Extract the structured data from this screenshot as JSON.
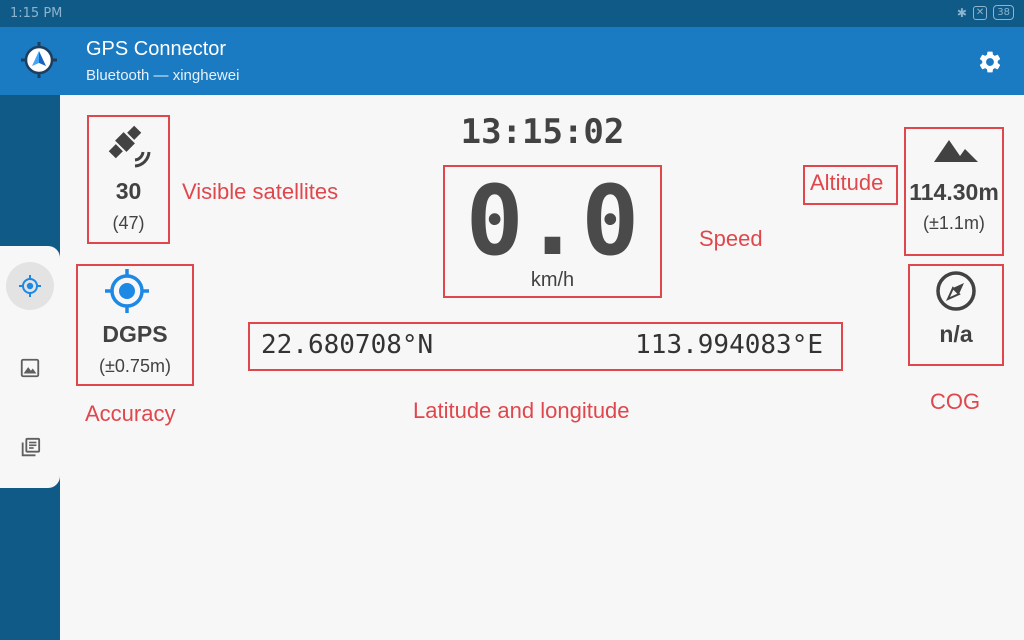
{
  "status_bar": {
    "time": "1:15 PM",
    "battery": "38"
  },
  "app": {
    "title": "GPS Connector",
    "subtitle": "Bluetooth — xinghewei"
  },
  "colors": {
    "appbar": "#1a7ac2",
    "statusbar": "#0f5a86",
    "accent": "#1e88e5",
    "annotation": "#e0474c",
    "text": "#424242"
  },
  "icons": {
    "app": "gps-logo-icon",
    "settings": "gear-icon",
    "satellite": "satellite-icon",
    "accuracy": "gps-fixed-icon",
    "altitude": "terrain-icon",
    "cog": "compass-icon"
  },
  "rail": [
    {
      "name": "rail-location",
      "icon": "crosshair-location-icon",
      "active": true
    },
    {
      "name": "rail-image",
      "icon": "image-icon",
      "active": false
    },
    {
      "name": "rail-log",
      "icon": "library-books-icon",
      "active": false
    }
  ],
  "clock": "13:15:02",
  "satellites": {
    "visible": "30",
    "total": "(47)"
  },
  "accuracy": {
    "fix": "DGPS",
    "value": "(±0.75m)"
  },
  "speed": {
    "value": "0.0",
    "unit": "km/h"
  },
  "position": {
    "latitude": "22.680708°N",
    "longitude": "113.994083°E"
  },
  "altitude": {
    "value": "114.30m",
    "error": "(±1.1m)"
  },
  "cog": {
    "value": "n/a"
  },
  "annotations": {
    "satellites": "Visible satellites",
    "speed": "Speed",
    "altitude": "Altitude",
    "accuracy": "Accuracy",
    "latlon": "Latitude and longitude",
    "cog": "COG"
  }
}
